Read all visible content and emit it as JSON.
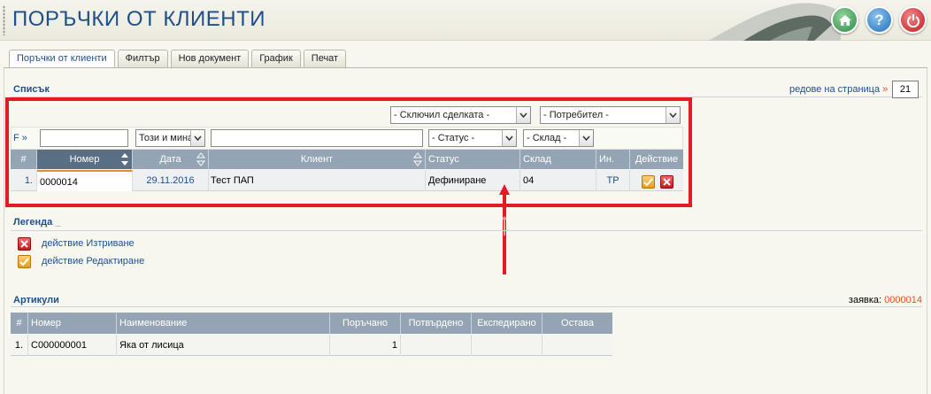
{
  "header": {
    "title": "ПОРЪЧКИ ОТ КЛИЕНТИ",
    "help_label": "?"
  },
  "tabs": [
    {
      "label": "Поръчки от клиенти",
      "active": true
    },
    {
      "label": "Филтър"
    },
    {
      "label": "Нов документ"
    },
    {
      "label": "График"
    },
    {
      "label": "Печат"
    }
  ],
  "list": {
    "title": "Списък",
    "rows_per_page_label": "редове на страница",
    "rows_per_page_arrow": "»",
    "rows_per_page_value": "21",
    "filters": {
      "deal_closer_select": "- Сключил сделката -",
      "consumer_select": "- Потребител -",
      "f_link": "F »",
      "number_value": "",
      "period_select": "Този и мина",
      "client_value": "",
      "status_select": "- Статус -",
      "warehouse_select": "- Склад -"
    },
    "columns": [
      "#",
      "Номер",
      "Дата",
      "Клиент",
      "Статус",
      "Склад",
      "Ин.",
      "Действие"
    ],
    "rows": [
      {
        "index": "1.",
        "number": "0000014",
        "date": "29.11.2016",
        "client": "Тест ПАП",
        "status": "Дефиниране",
        "warehouse": "04",
        "initials": "ТР"
      }
    ]
  },
  "legend": {
    "title": "Легенда",
    "toggle": "_",
    "items": [
      {
        "label": "действие Изтриване",
        "icon": "delete-icon"
      },
      {
        "label": "действие Редактиране",
        "icon": "edit-icon"
      }
    ]
  },
  "articles": {
    "title": "Артикули",
    "order_label": "заявка:",
    "order_value": "0000014",
    "columns": [
      "#",
      "Номер",
      "Наименование",
      "Поръчано",
      "Потвърдено",
      "Експедирано",
      "Остава"
    ],
    "rows": [
      {
        "index": "1.",
        "number": "C000000001",
        "name": "Яка от лисица",
        "ordered": "1",
        "confirmed": "",
        "shipped": "",
        "remaining": ""
      }
    ]
  },
  "colors": {
    "title": "#1f4f8a",
    "header_grey": "#95a4b4",
    "sorted_col": "#5b6f84",
    "highlight_red": "#e21b26",
    "link_orange": "#e0502a"
  }
}
